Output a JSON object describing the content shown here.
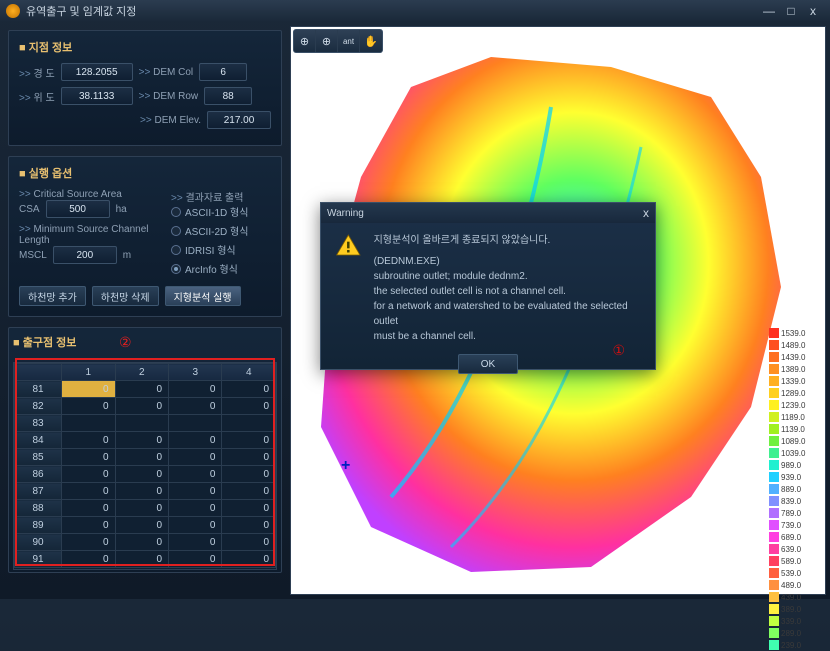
{
  "window": {
    "title": "유역출구 및 임계값 지정",
    "min_icon": "—",
    "max_icon": "□",
    "close_icon": "x"
  },
  "point_info": {
    "title": "지점 정보",
    "lon_label": "경 도",
    "lon": "128.2055",
    "lat_label": "위 도",
    "lat": "38.1133",
    "demcol_label": "DEM Col",
    "demcol": "6",
    "demrow_label": "DEM Row",
    "demrow": "88",
    "demelev_label": "DEM Elev.",
    "demelev": "217.00"
  },
  "exec_opts": {
    "title": "실행 옵션",
    "csa_label": "Critical Source Area",
    "csa_name": "CSA",
    "csa": "500",
    "csa_unit": "ha",
    "mscl_label": "Minimum Source Channel Length",
    "mscl_name": "MSCL",
    "mscl": "200",
    "mscl_unit": "m",
    "output_label": "결과자료 출력",
    "fmt": {
      "ascii1d": "ASCII-1D 형식",
      "ascii2d": "ASCII-2D 형식",
      "idrisi": "IDRISI 형식",
      "arcinfo": "ArcInfo 형식"
    },
    "selected_fmt": "arcinfo",
    "btn_add": "하천망 추가",
    "btn_del": "하천망 삭제",
    "btn_run": "지형분석 실행"
  },
  "outlet": {
    "title": "출구점 정보",
    "circ2": "②",
    "cols": [
      "",
      "1",
      "2",
      "3",
      "4"
    ],
    "rows": [
      {
        "h": "81",
        "v": [
          "0",
          "0",
          "0",
          "0"
        ],
        "sel": 0
      },
      {
        "h": "82",
        "v": [
          "0",
          "0",
          "0",
          "0"
        ]
      },
      {
        "h": "83",
        "v": [
          "",
          "",
          "",
          ""
        ]
      },
      {
        "h": "84",
        "v": [
          "0",
          "0",
          "0",
          "0"
        ]
      },
      {
        "h": "85",
        "v": [
          "0",
          "0",
          "0",
          "0"
        ]
      },
      {
        "h": "86",
        "v": [
          "0",
          "0",
          "0",
          "0"
        ]
      },
      {
        "h": "87",
        "v": [
          "0",
          "0",
          "0",
          "0"
        ]
      },
      {
        "h": "88",
        "v": [
          "0",
          "0",
          "0",
          "0"
        ]
      },
      {
        "h": "89",
        "v": [
          "0",
          "0",
          "0",
          "0"
        ]
      },
      {
        "h": "90",
        "v": [
          "0",
          "0",
          "0",
          "0"
        ]
      },
      {
        "h": "91",
        "v": [
          "0",
          "0",
          "0",
          "0"
        ]
      }
    ]
  },
  "map": {
    "tools": {
      "zoom_extent": "⊕",
      "zoom_in": "⊕",
      "info": "ant",
      "pan": "✋"
    },
    "crosshair": "+"
  },
  "legend": [
    {
      "c": "#ff3020",
      "v": "1539.0"
    },
    {
      "c": "#ff5020",
      "v": "1489.0"
    },
    {
      "c": "#ff7020",
      "v": "1439.0"
    },
    {
      "c": "#ff9020",
      "v": "1389.0"
    },
    {
      "c": "#ffb020",
      "v": "1339.0"
    },
    {
      "c": "#ffd020",
      "v": "1289.0"
    },
    {
      "c": "#fff020",
      "v": "1239.0"
    },
    {
      "c": "#d0f020",
      "v": "1189.0"
    },
    {
      "c": "#a0f020",
      "v": "1139.0"
    },
    {
      "c": "#70f040",
      "v": "1089.0"
    },
    {
      "c": "#40f090",
      "v": "1039.0"
    },
    {
      "c": "#20f0d0",
      "v": "989.0"
    },
    {
      "c": "#20d0ff",
      "v": "939.0"
    },
    {
      "c": "#50b0ff",
      "v": "889.0"
    },
    {
      "c": "#8090ff",
      "v": "839.0"
    },
    {
      "c": "#b070ff",
      "v": "789.0"
    },
    {
      "c": "#e050ff",
      "v": "739.0"
    },
    {
      "c": "#ff40e0",
      "v": "689.0"
    },
    {
      "c": "#ff40a0",
      "v": "639.0"
    },
    {
      "c": "#ff4060",
      "v": "589.0"
    },
    {
      "c": "#ff6040",
      "v": "539.0"
    },
    {
      "c": "#ff9040",
      "v": "489.0"
    },
    {
      "c": "#ffc040",
      "v": "439.0"
    },
    {
      "c": "#fff040",
      "v": "389.0"
    },
    {
      "c": "#c0ff40",
      "v": "339.0"
    },
    {
      "c": "#80ff60",
      "v": "289.0"
    },
    {
      "c": "#40ffb0",
      "v": "239.0"
    }
  ],
  "dialog": {
    "title": "Warning",
    "close": "x",
    "line1": "지형분석이 올바르게 종료되지 않았습니다.",
    "line2": "(DEDNM.EXE)",
    "line3": "subroutine outlet; module dednm2.",
    "line4": "the selected outlet cell is not a channel cell.",
    "line5": "for a network and watershed to be evaluated the selected outlet",
    "line6": "must be a channel cell.",
    "ok": "OK",
    "circ1": "①"
  }
}
